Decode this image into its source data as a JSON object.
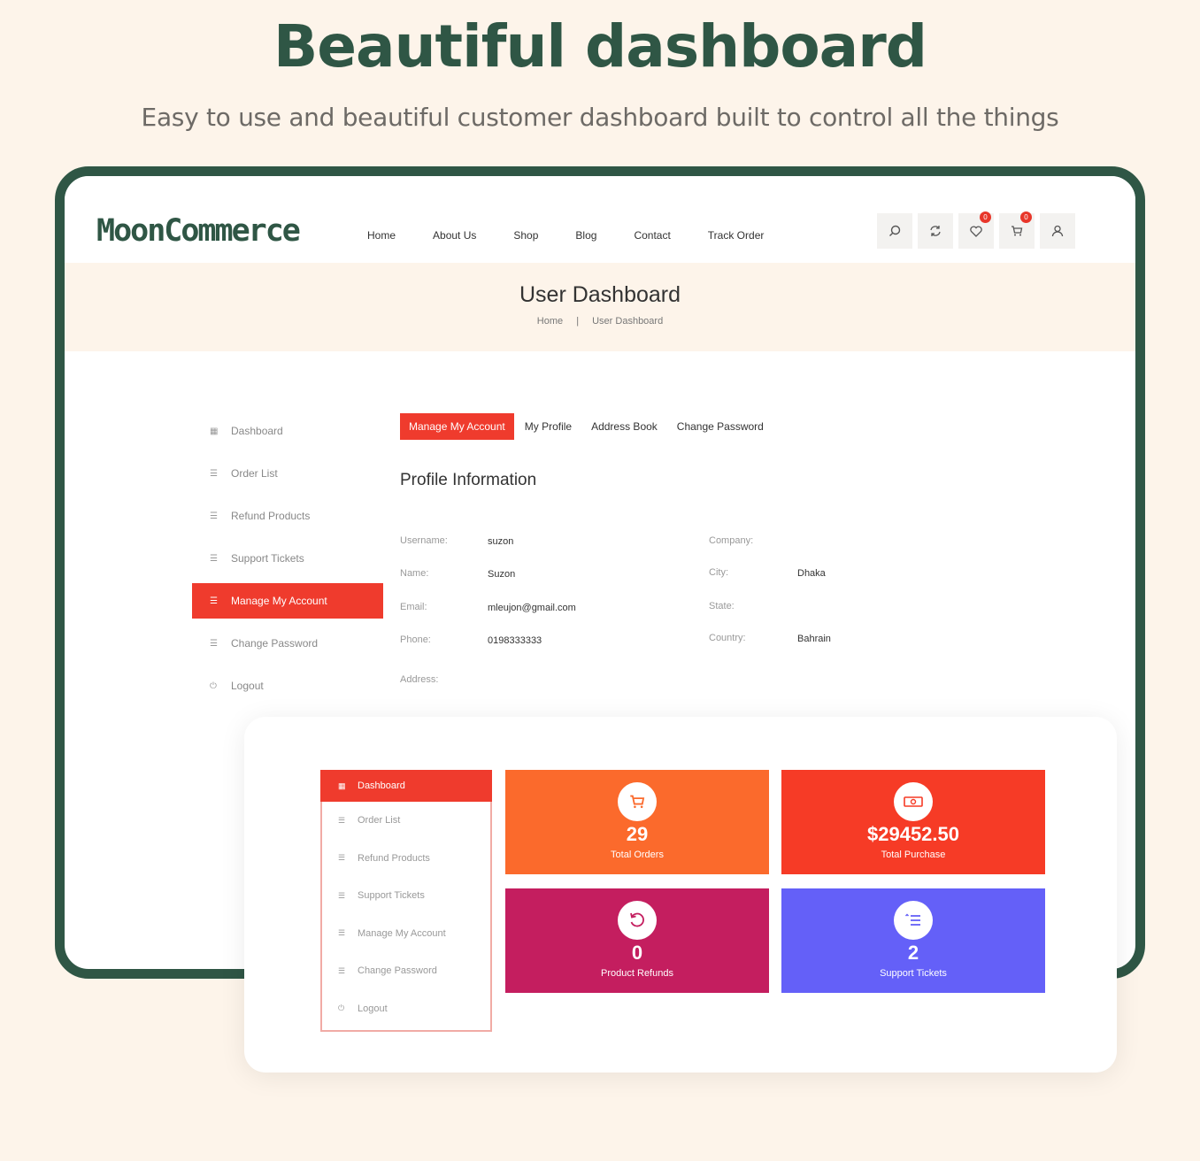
{
  "hero": {
    "title": "Beautiful dashboard",
    "subtitle": "Easy to use and beautiful customer dashboard built to  control all the things"
  },
  "nav": {
    "logo": "MoonCommerce",
    "menu": [
      "Home",
      "About Us",
      "Shop",
      "Blog",
      "Contact",
      "Track Order"
    ],
    "wishlist_count": "0",
    "cart_count": "0"
  },
  "banner": {
    "title": "User Dashboard",
    "crumb_home": "Home",
    "crumb_sep": "|",
    "crumb_current": "User Dashboard"
  },
  "sidebar": {
    "items": [
      "Dashboard",
      "Order List",
      "Refund Products",
      "Support Tickets",
      "Manage My Account",
      "Change Password",
      "Logout"
    ],
    "active": "Manage My Account"
  },
  "tabs": [
    "Manage My Account",
    "My Profile",
    "Address Book",
    "Change Password"
  ],
  "profile": {
    "heading": "Profile Information",
    "username_label": "Username:",
    "username": "suzon",
    "name_label": "Name:",
    "name": "Suzon",
    "email_label": "Email:",
    "email": "mleujon@gmail.com",
    "phone_label": "Phone:",
    "phone": "0198333333",
    "address_label": "Address:",
    "company_label": "Company:",
    "city_label": "City:",
    "city": "Dhaka",
    "state_label": "State:",
    "country_label": "Country:",
    "country": "Bahrain"
  },
  "mini_sidebar": {
    "items": [
      "Dashboard",
      "Order List",
      "Refund Products",
      "Support Tickets",
      "Manage My Account",
      "Change Password",
      "Logout"
    ]
  },
  "stats": [
    {
      "value": "29",
      "label": "Total Orders",
      "color": "#fb6a2c",
      "icon": "cart-icon"
    },
    {
      "value": "$29452.50",
      "label": "Total Purchase",
      "color": "#f63b26",
      "icon": "money-icon"
    },
    {
      "value": "0",
      "label": "Product Refunds",
      "color": "#c41e5f",
      "icon": "refund-icon"
    },
    {
      "value": "2",
      "label": "Support Tickets",
      "color": "#6460f8",
      "icon": "list-icon"
    }
  ]
}
